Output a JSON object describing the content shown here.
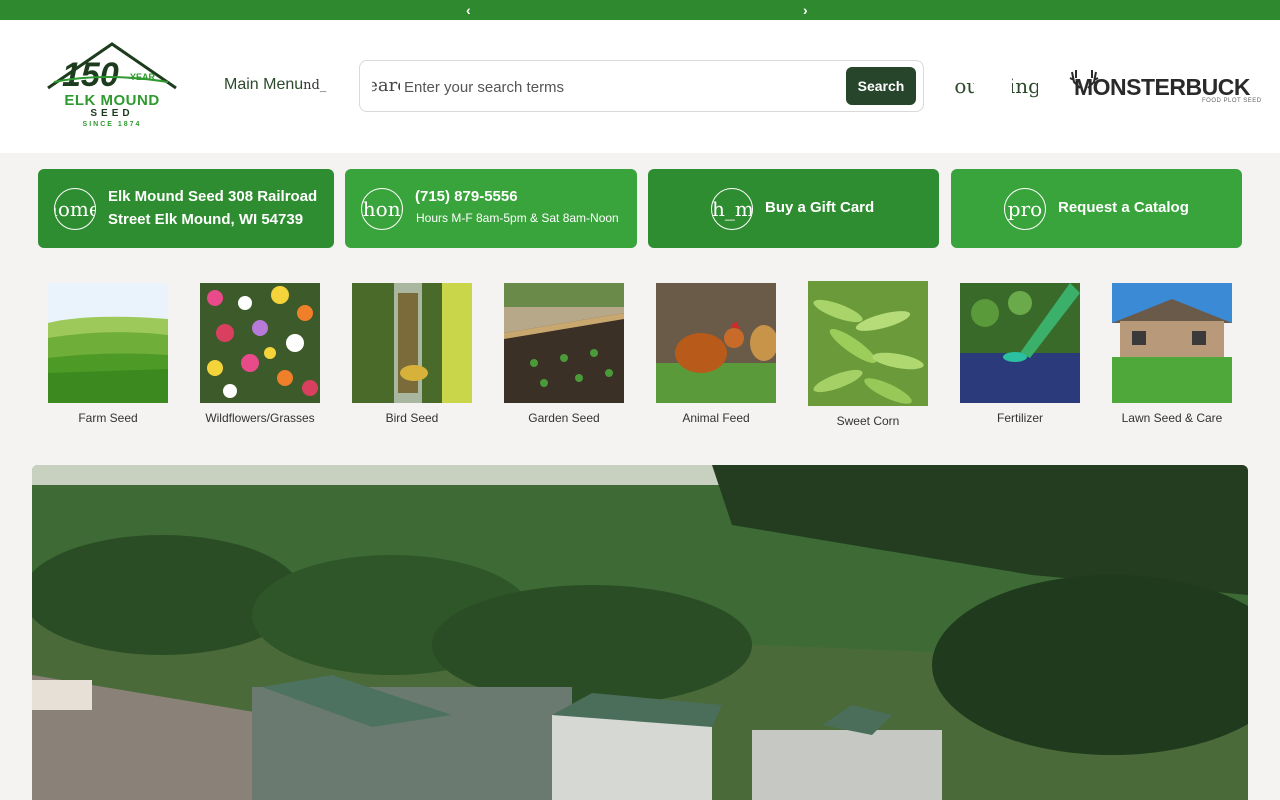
{
  "carousel": {
    "prev": "‹",
    "next": "›"
  },
  "logo": {
    "year_number": "150",
    "year_label": "YEAR",
    "brand": "ELK MOUND",
    "seed": "SEED",
    "since": "SINCE 1874"
  },
  "header": {
    "main_menu": "Main Menu",
    "main_menu_fragment": "nd_",
    "search_icon_text": "search",
    "search_placeholder": "Enter your search terms",
    "search_button": "Search",
    "account_icon_text": "account",
    "shopping_icon_text": "shopping",
    "partner_logo": "MONSTERBUCK",
    "partner_tagline": "FOOD PLOT SEED"
  },
  "info_cards": [
    {
      "icon_text": "home",
      "title": "Elk Mound Seed 308 Railroad Street Elk Mound, WI 54739"
    },
    {
      "icon_text": "phone",
      "title": "(715) 879-5556",
      "subtitle": "Hours M-F 8am-5pm & Sat 8am-Noon"
    },
    {
      "icon_text": "h_m",
      "title": "Buy a Gift Card"
    },
    {
      "icon_text": "pro",
      "title": "Request a Catalog"
    }
  ],
  "categories": [
    {
      "label": "Farm Seed"
    },
    {
      "label": "Wildflowers/Grasses"
    },
    {
      "label": "Bird Seed"
    },
    {
      "label": "Garden Seed"
    },
    {
      "label": "Animal Feed"
    },
    {
      "label": "Sweet Corn"
    },
    {
      "label": "Fertilizer"
    },
    {
      "label": "Lawn Seed & Care"
    }
  ],
  "colors": {
    "brand_green": "#2f8a2f",
    "light_green": "#3aa43c",
    "dark_button": "#27452a"
  }
}
